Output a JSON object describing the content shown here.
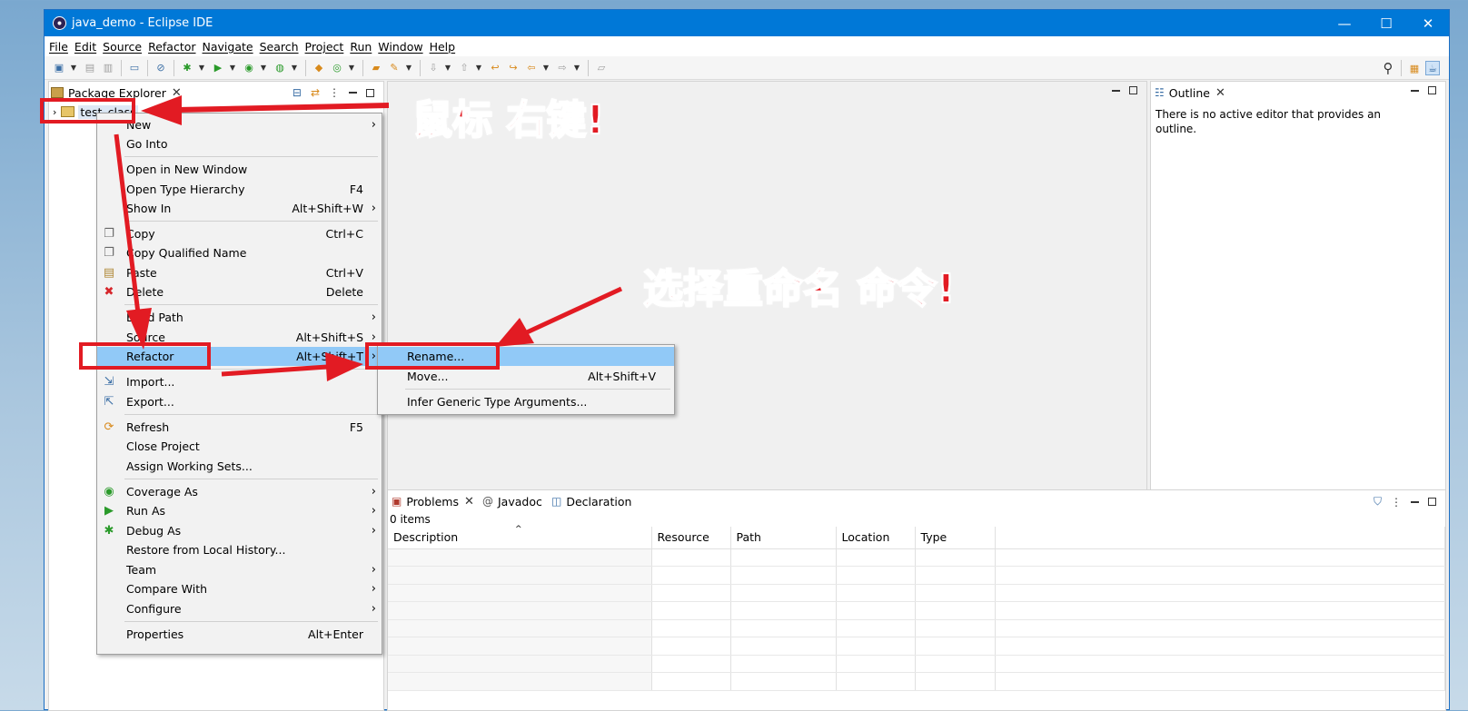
{
  "window": {
    "title": "java_demo - Eclipse IDE",
    "controls": {
      "minimize": "—",
      "maximize": "☐",
      "close": "✕"
    }
  },
  "menubar": [
    "File",
    "Edit",
    "Source",
    "Refactor",
    "Navigate",
    "Search",
    "Project",
    "Run",
    "Window",
    "Help"
  ],
  "package_explorer": {
    "tab_label": "Package Explorer",
    "project": "test_class"
  },
  "outline": {
    "tab_label": "Outline",
    "message": "There is no active editor that provides an outline."
  },
  "bottom_panel": {
    "tabs": [
      "Problems",
      "Javadoc",
      "Declaration"
    ],
    "count": "0 items",
    "columns": [
      "Description",
      "Resource",
      "Path",
      "Location",
      "Type"
    ]
  },
  "context_menu": {
    "items": [
      {
        "label": "New",
        "shortcut": "",
        "arrow": "›"
      },
      {
        "label": "Go Into",
        "shortcut": "",
        "arrow": ""
      },
      {
        "label": "Open in New Window",
        "shortcut": "",
        "arrow": ""
      },
      {
        "label": "Open Type Hierarchy",
        "shortcut": "F4",
        "arrow": ""
      },
      {
        "label": "Show In",
        "shortcut": "Alt+Shift+W",
        "arrow": "›"
      },
      {
        "label": "Copy",
        "shortcut": "Ctrl+C",
        "arrow": ""
      },
      {
        "label": "Copy Qualified Name",
        "shortcut": "",
        "arrow": ""
      },
      {
        "label": "Paste",
        "shortcut": "Ctrl+V",
        "arrow": ""
      },
      {
        "label": "Delete",
        "shortcut": "Delete",
        "arrow": ""
      },
      {
        "label": "Build Path",
        "shortcut": "",
        "arrow": "›"
      },
      {
        "label": "Source",
        "shortcut": "Alt+Shift+S",
        "arrow": "›"
      },
      {
        "label": "Refactor",
        "shortcut": "Alt+Shift+T",
        "arrow": "›"
      },
      {
        "label": "Import...",
        "shortcut": "",
        "arrow": ""
      },
      {
        "label": "Export...",
        "shortcut": "",
        "arrow": ""
      },
      {
        "label": "Refresh",
        "shortcut": "F5",
        "arrow": ""
      },
      {
        "label": "Close Project",
        "shortcut": "",
        "arrow": ""
      },
      {
        "label": "Assign Working Sets...",
        "shortcut": "",
        "arrow": ""
      },
      {
        "label": "Coverage As",
        "shortcut": "",
        "arrow": "›"
      },
      {
        "label": "Run As",
        "shortcut": "",
        "arrow": "›"
      },
      {
        "label": "Debug As",
        "shortcut": "",
        "arrow": "›"
      },
      {
        "label": "Restore from Local History...",
        "shortcut": "",
        "arrow": ""
      },
      {
        "label": "Team",
        "shortcut": "",
        "arrow": "›"
      },
      {
        "label": "Compare With",
        "shortcut": "",
        "arrow": "›"
      },
      {
        "label": "Configure",
        "shortcut": "",
        "arrow": "›"
      },
      {
        "label": "Properties",
        "shortcut": "Alt+Enter",
        "arrow": ""
      }
    ]
  },
  "refactor_submenu": {
    "items": [
      {
        "label": "Rename...",
        "shortcut": ""
      },
      {
        "label": "Move...",
        "shortcut": "Alt+Shift+V"
      },
      {
        "label": "Infer Generic Type Arguments...",
        "shortcut": ""
      }
    ]
  },
  "annotations": {
    "right_click": "鼠标 右键!",
    "choose_rename": "选择重命名 命令!"
  },
  "colors": {
    "accent": "#0078d7",
    "annotation": "#e21b23",
    "highlight": "#91c9f7"
  }
}
